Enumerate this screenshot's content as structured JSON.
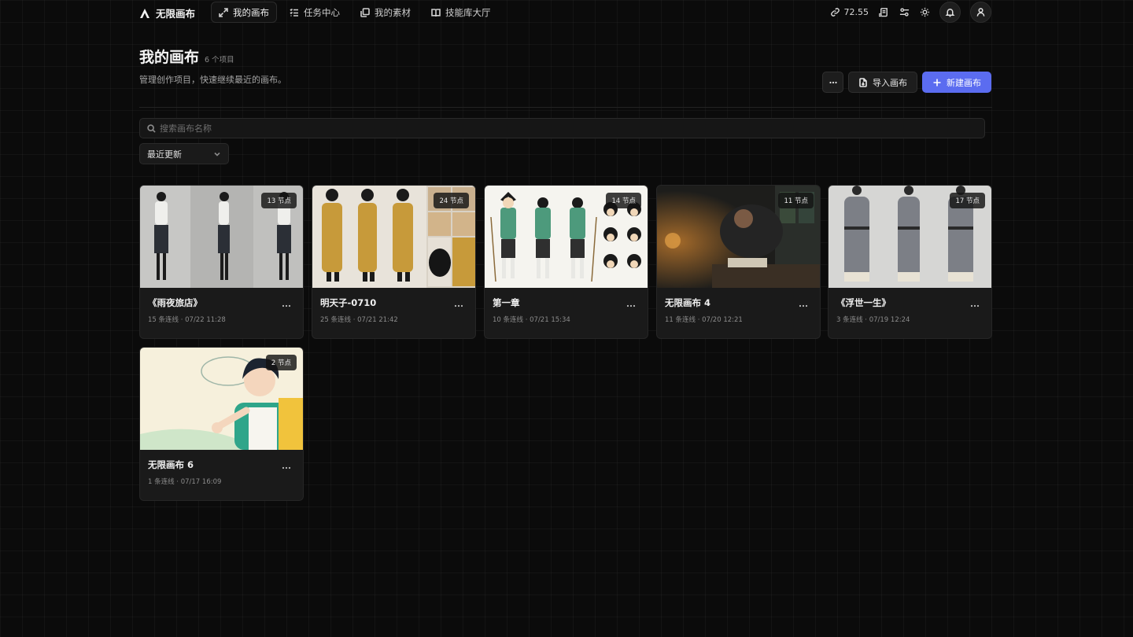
{
  "app": {
    "name": "无限画布"
  },
  "nav": [
    {
      "label": "我的画布",
      "icon": "expand-arrows-icon",
      "active": true
    },
    {
      "label": "任务中心",
      "icon": "task-list-icon",
      "active": false
    },
    {
      "label": "我的素材",
      "icon": "assets-icon",
      "active": false
    },
    {
      "label": "技能库大厅",
      "icon": "book-icon",
      "active": false
    }
  ],
  "topbar": {
    "credits": "72.55"
  },
  "header": {
    "title": "我的画布",
    "count": "6 个项目",
    "subtitle": "管理创作项目，快速继续最近的画布。",
    "import_label": "导入画布",
    "new_label": "新建画布"
  },
  "search": {
    "placeholder": "搜索画布名称"
  },
  "sort": {
    "selected": "最近更新"
  },
  "colors": {
    "accent": "#5b6cf0",
    "background": "#0b0b0b",
    "card": "#1a1a1a"
  },
  "cards": [
    {
      "title": "《雨夜旅店》",
      "meta": "15 条连线 · 07/22 11:28",
      "badge": "13 节点"
    },
    {
      "title": "明天子-0710",
      "meta": "25 条连线 · 07/21 21:42",
      "badge": "24 节点"
    },
    {
      "title": "第一章",
      "meta": "10 条连线 · 07/21 15:34",
      "badge": "14 节点"
    },
    {
      "title": "无限画布 4",
      "meta": "11 条连线 · 07/20 12:21",
      "badge": "11 节点"
    },
    {
      "title": "《浮世一生》",
      "meta": "3 条连线 · 07/19 12:24",
      "badge": "17 节点"
    },
    {
      "title": "无限画布 6",
      "meta": "1 条连线 · 07/17 16:09",
      "badge": "2 节点"
    }
  ]
}
